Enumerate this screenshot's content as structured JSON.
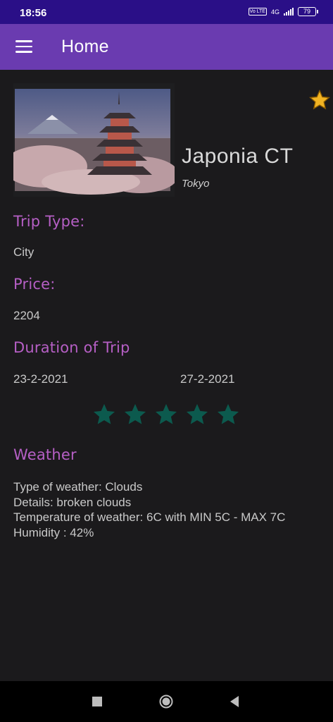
{
  "status_bar": {
    "time": "18:56",
    "volte": "Vo LTE",
    "network": "4G",
    "battery": "79"
  },
  "app_bar": {
    "title": "Home"
  },
  "trip": {
    "name": "Japonia CT",
    "city": "Tokyo",
    "favorite": true
  },
  "sections": {
    "trip_type_label": "Trip Type:",
    "trip_type_value": "City",
    "price_label": "Price:",
    "price_value": "2204",
    "duration_label": "Duration of Trip",
    "start_date": "23-2-2021",
    "end_date": "27-2-2021",
    "weather_label": "Weather"
  },
  "rating": {
    "stars": 5,
    "max": 5,
    "color": "#0c5a4e"
  },
  "weather": {
    "type_line": "Type of weather: Clouds",
    "details_line": "Details: broken clouds",
    "temperature_line": "Temperature of weather: 6C with MIN 5C - MAX 7C",
    "humidity_line": "Humidity : 42%"
  },
  "colors": {
    "status_bar": "#2a0f87",
    "app_bar": "#6a3bb0",
    "background": "#1b1a1c",
    "accent_label": "#b65fc5",
    "favorite_star": "#f0b323"
  }
}
